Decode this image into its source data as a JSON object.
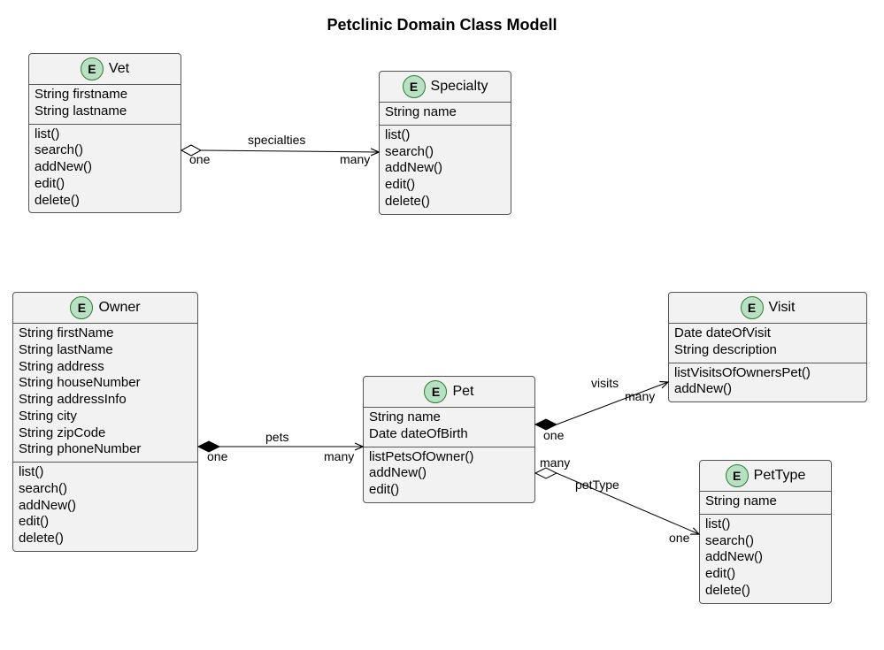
{
  "title": "Petclinic Domain Class Modell",
  "stereotype_letter": "E",
  "classes": {
    "vet": {
      "name": "Vet",
      "attrs": [
        "String firstname",
        "String lastname"
      ],
      "ops": [
        "list()",
        "search()",
        "addNew()",
        "edit()",
        "delete()"
      ]
    },
    "specialty": {
      "name": "Specialty",
      "attrs": [
        "String name"
      ],
      "ops": [
        "list()",
        "search()",
        "addNew()",
        "edit()",
        "delete()"
      ]
    },
    "owner": {
      "name": "Owner",
      "attrs": [
        "String firstName",
        "String lastName",
        "String address",
        "String houseNumber",
        "String addressInfo",
        "String city",
        "String zipCode",
        "String phoneNumber"
      ],
      "ops": [
        "list()",
        "search()",
        "addNew()",
        "edit()",
        "delete()"
      ]
    },
    "pet": {
      "name": "Pet",
      "attrs": [
        "String name",
        "Date dateOfBirth"
      ],
      "ops": [
        "listPetsOfOwner()",
        "addNew()",
        "edit()"
      ]
    },
    "visit": {
      "name": "Visit",
      "attrs": [
        "Date dateOfVisit",
        "String description"
      ],
      "ops": [
        "listVisitsOfOwnersPet()",
        "addNew()"
      ]
    },
    "pettype": {
      "name": "PetType",
      "attrs": [
        "String name"
      ],
      "ops": [
        "list()",
        "search()",
        "addNew()",
        "edit()",
        "delete()"
      ]
    }
  },
  "assocs": {
    "vet_specialty": {
      "name": "specialties",
      "from_mult": "one",
      "to_mult": "many",
      "kind": "aggregation"
    },
    "owner_pet": {
      "name": "pets",
      "from_mult": "one",
      "to_mult": "many",
      "kind": "composition"
    },
    "pet_visit": {
      "name": "visits",
      "from_mult": "one",
      "to_mult": "many",
      "kind": "composition"
    },
    "pet_pettype": {
      "name": "petType",
      "from_mult": "many",
      "to_mult": "one",
      "kind": "aggregation"
    }
  }
}
